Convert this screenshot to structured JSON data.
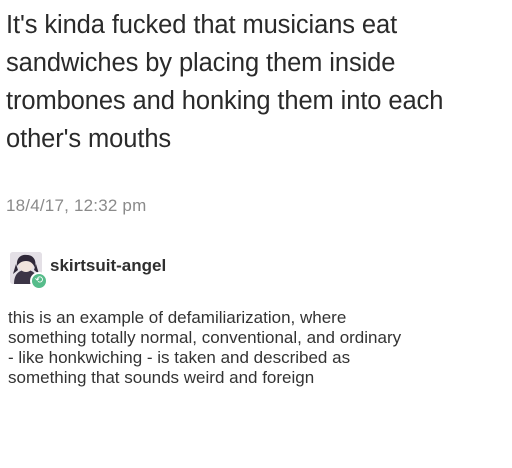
{
  "post": {
    "lines": [
      "It's kinda fucked that musicians eat",
      "sandwiches by placing them inside",
      "trombones and honking them into each",
      "other's mouths"
    ],
    "timestamp": "18/4/17, 12:32 pm"
  },
  "reblog": {
    "username": "skirtsuit-angel",
    "avatar_icon": "user-avatar",
    "reblog_icon": "reblog-icon",
    "reblog_icon_color": "#56bc8a",
    "lines": [
      "this is an example of defamiliarization, where",
      "something totally normal, conventional, and ordinary",
      "- like honkwiching - is taken and described as",
      "something that sounds weird and foreign"
    ]
  }
}
